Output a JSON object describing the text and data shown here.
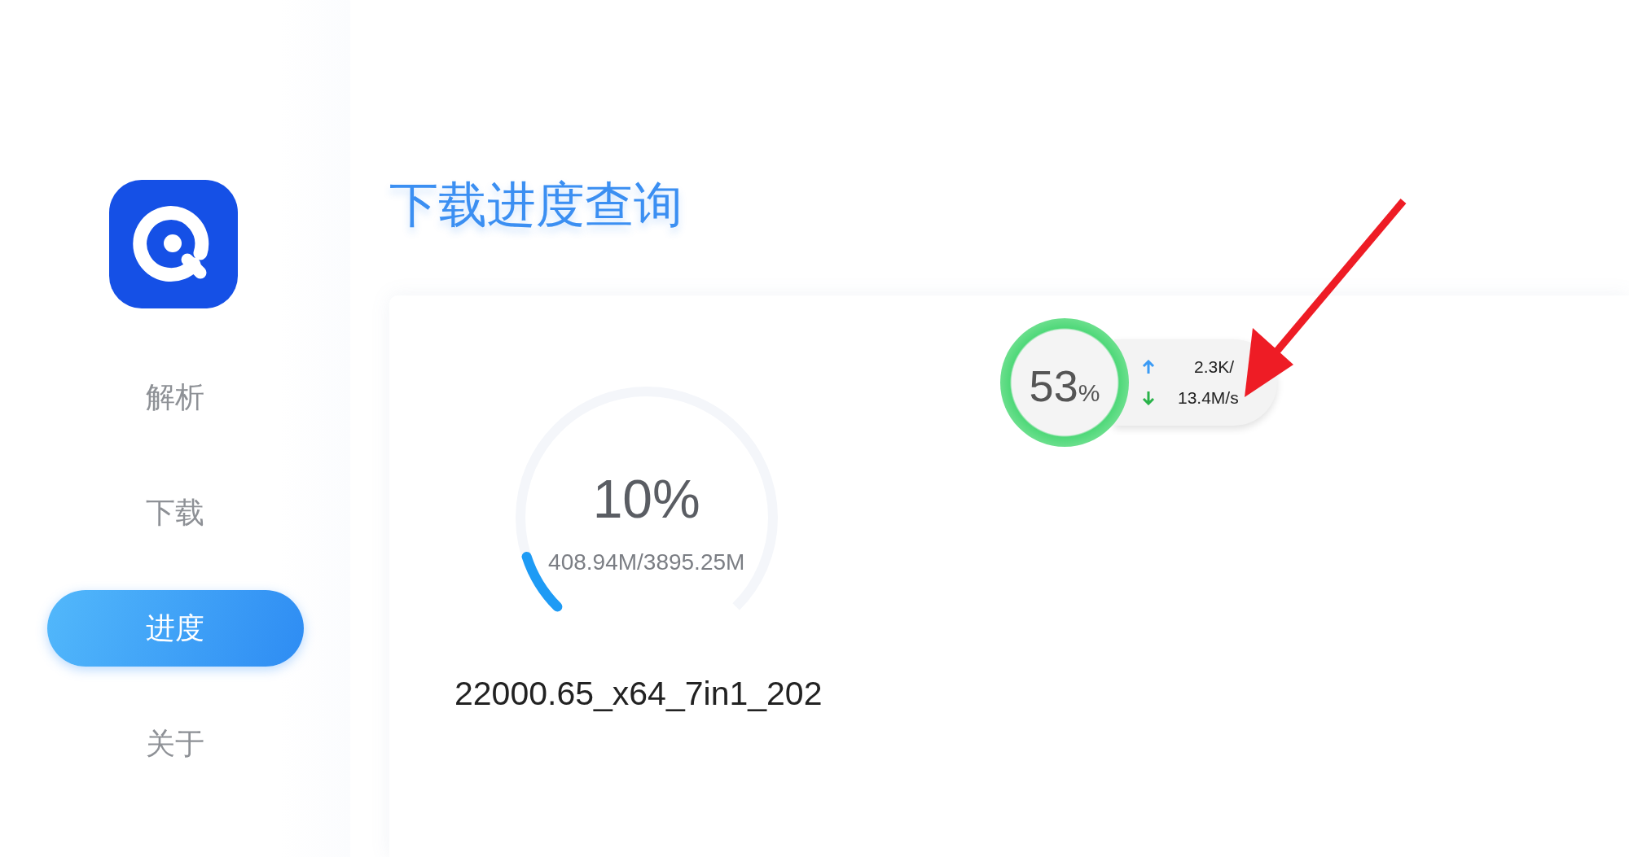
{
  "sidebar": {
    "items": [
      {
        "label": "解析",
        "selected": false
      },
      {
        "label": "下载",
        "selected": false
      },
      {
        "label": "进度",
        "selected": true
      },
      {
        "label": "关于",
        "selected": false
      }
    ]
  },
  "page_title": "下载进度查询",
  "download": {
    "percent": "10%",
    "size": "408.94M/3895.25M",
    "level": 0.1,
    "file_name": "22000.65_x64_7in1_202"
  },
  "speed_widget": {
    "percent": "53",
    "percent_sign": "%",
    "upload": "2.3K/",
    "download": "13.4M/s"
  }
}
